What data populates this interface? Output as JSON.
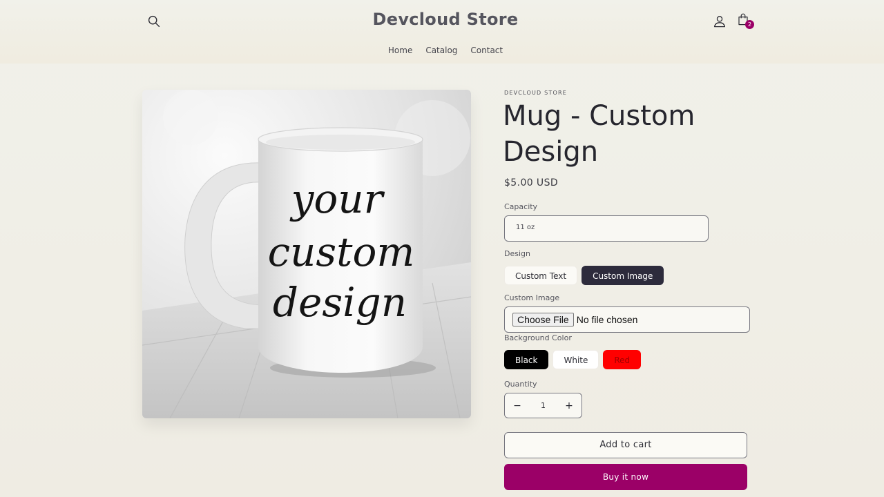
{
  "header": {
    "store_name": "Devcloud Store",
    "cart_count": "2",
    "nav": [
      "Home",
      "Catalog",
      "Contact"
    ],
    "icons": {
      "search": "search-icon",
      "account": "account-icon",
      "cart": "cart-icon"
    }
  },
  "product": {
    "vendor": "DEVCLOUD STORE",
    "title": "Mug - Custom Design",
    "price": "$5.00 USD",
    "image_text": [
      "your",
      "custom",
      "design"
    ],
    "capacity": {
      "label": "Capacity",
      "value": "11 oz"
    },
    "design": {
      "label": "Design",
      "options": [
        "Custom Text",
        "Custom Image"
      ],
      "selected": "Custom Image"
    },
    "custom_image": {
      "label": "Custom Image",
      "button": "Choose File",
      "status": "No file chosen"
    },
    "background_color": {
      "label": "Background Color",
      "options": [
        "Black",
        "White",
        "Red"
      ]
    },
    "quantity": {
      "label": "Quantity",
      "value": "1",
      "decrement": "−",
      "increment": "+"
    },
    "add_to_cart": "Add to cart",
    "buy_now": "Buy it now"
  },
  "colors": {
    "accent": "#9b0067",
    "selected_pill": "#2d2b3c",
    "swatch_black": "#000000",
    "swatch_white": "#ffffff",
    "swatch_red": "#ff0000"
  }
}
